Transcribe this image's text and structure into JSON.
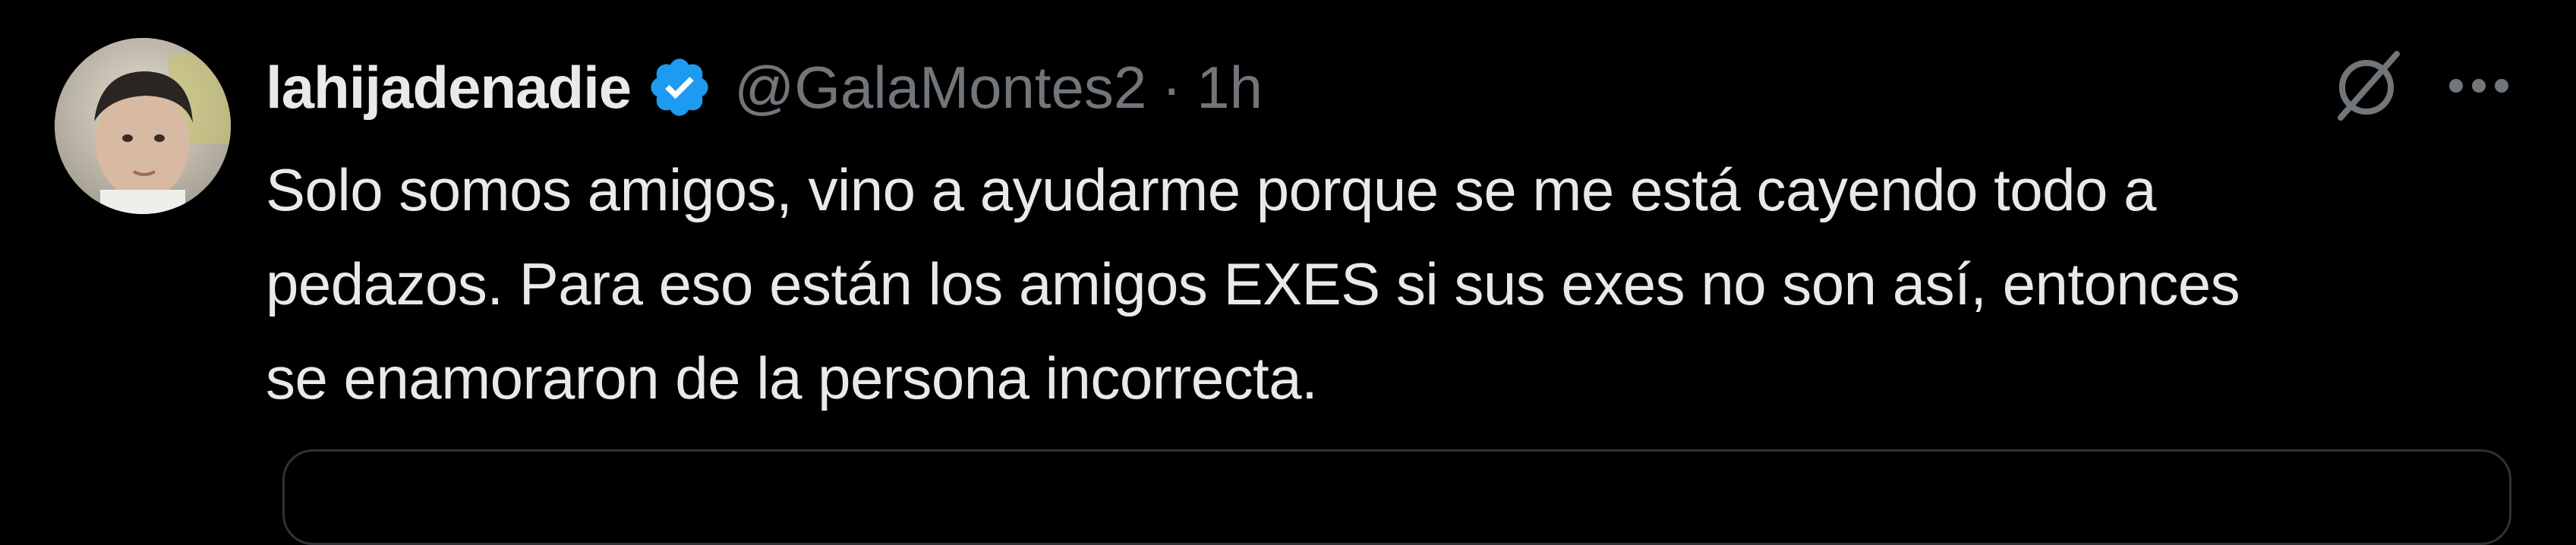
{
  "tweet": {
    "display_name": "lahijadenadie",
    "handle": "@GalaMontes2",
    "separator": "·",
    "time": "1h",
    "text_lines": [
      "Solo somos amigos, vino a ayudarme porque se me está cayendo todo a",
      "pedazos. Para eso están los amigos EXES si sus exes no son así, entonces",
      "se enamoraron de la persona incorrecta."
    ],
    "icons": {
      "verified": "verified-badge-icon",
      "grok": "grok-icon",
      "more": "more-options-icon"
    }
  },
  "colors": {
    "background": "#000000",
    "primary_text": "#e7e9ea",
    "secondary_text": "#71767b",
    "verified_blue": "#1d9bf0",
    "border": "#2f3336"
  }
}
